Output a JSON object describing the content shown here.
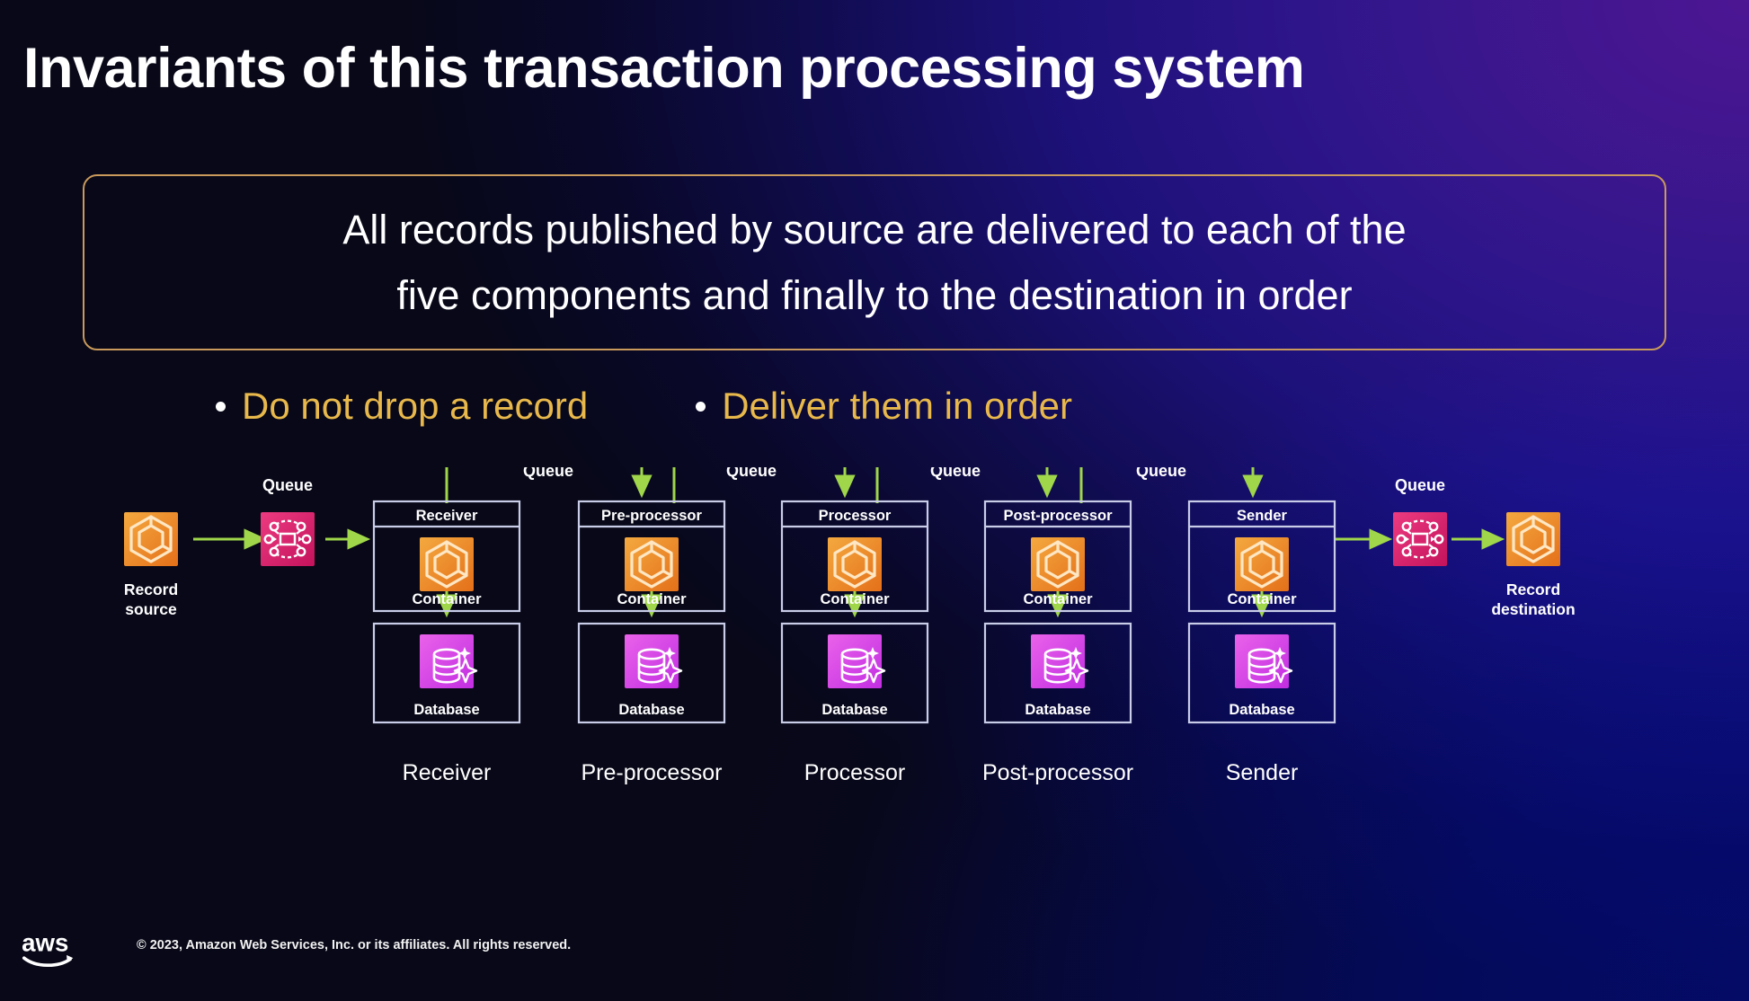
{
  "slide": {
    "title": "Invariants of this transaction processing system",
    "callout": {
      "line1": "All records published by source are delivered to each of the",
      "line2": "five components and finally to the destination in order",
      "border_color": "#c99a5b"
    },
    "bullets": [
      {
        "text": "Do not drop a record"
      },
      {
        "text": "Deliver them in order"
      }
    ],
    "bullet_color": "#e8b84b"
  },
  "diagram": {
    "source": {
      "label_line1": "Record",
      "label_line2": "source",
      "icon": "compute-hexagon-icon"
    },
    "destination": {
      "label_line1": "Record",
      "label_line2": "destination",
      "icon": "compute-hexagon-icon"
    },
    "ingress_queue": {
      "label": "Queue",
      "icon": "queue-mesh-icon"
    },
    "egress_queue": {
      "label": "Queue",
      "icon": "queue-mesh-icon"
    },
    "inter_queues": [
      {
        "label": "Queue",
        "icon": "queue-mesh-icon"
      },
      {
        "label": "Queue",
        "icon": "queue-mesh-icon"
      },
      {
        "label": "Queue",
        "icon": "queue-mesh-icon"
      },
      {
        "label": "Queue",
        "icon": "queue-mesh-icon"
      }
    ],
    "components": [
      {
        "header": "Receiver",
        "container_label": "Container",
        "database_label": "Database",
        "caption": "Receiver"
      },
      {
        "header": "Pre-processor",
        "container_label": "Container",
        "database_label": "Database",
        "caption": "Pre-processor"
      },
      {
        "header": "Processor",
        "container_label": "Container",
        "database_label": "Database",
        "caption": "Processor"
      },
      {
        "header": "Post-processor",
        "container_label": "Container",
        "database_label": "Database",
        "caption": "Post-processor"
      },
      {
        "header": "Sender",
        "container_label": "Container",
        "database_label": "Database",
        "caption": "Sender"
      }
    ],
    "colors": {
      "compute_from": "#f2a23c",
      "compute_to": "#e8751a",
      "queue_from": "#e8367e",
      "queue_to": "#c9195f",
      "database_from": "#e85ee8",
      "database_to": "#c432e0",
      "arrow": "#9fd64a",
      "box_stroke": "#c9cde8"
    }
  },
  "footer": {
    "copyright": "© 2023, Amazon Web Services, Inc. or its affiliates. All rights reserved.",
    "logo": "aws-logo"
  }
}
